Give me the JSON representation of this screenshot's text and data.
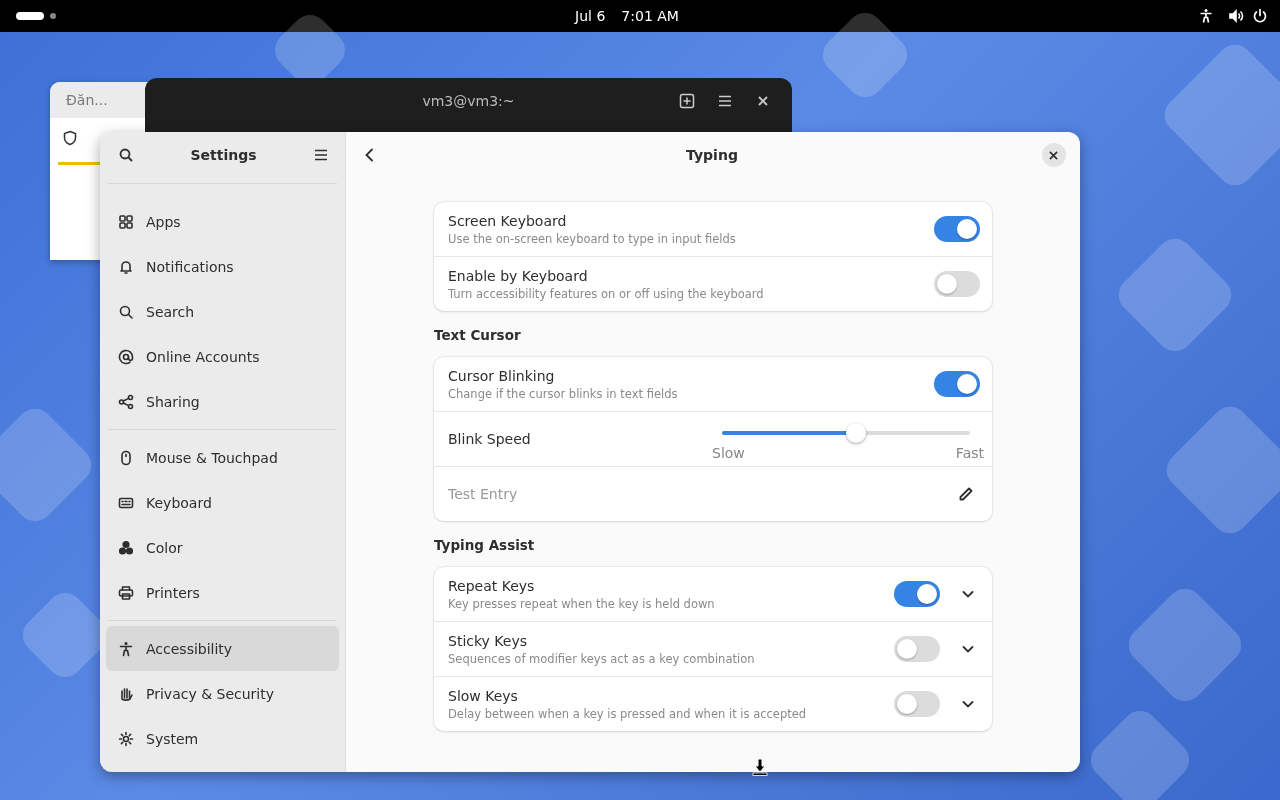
{
  "top_bar": {
    "date": "Jul 6",
    "time": "7:01 AM"
  },
  "background_windows": [
    {
      "kind": "browser",
      "title": "Đăn..."
    },
    {
      "kind": "terminal",
      "title": "vm3@vm3:~"
    }
  ],
  "settings": {
    "sidebar": {
      "title": "Settings",
      "groups": [
        [
          {
            "label": "Apps",
            "selected": false
          },
          {
            "label": "Notifications",
            "selected": false
          },
          {
            "label": "Search",
            "selected": false
          },
          {
            "label": "Online Accounts",
            "selected": false
          },
          {
            "label": "Sharing",
            "selected": false
          }
        ],
        [
          {
            "label": "Mouse & Touchpad",
            "selected": false
          },
          {
            "label": "Keyboard",
            "selected": false
          },
          {
            "label": "Color",
            "selected": false
          },
          {
            "label": "Printers",
            "selected": false
          }
        ],
        [
          {
            "label": "Accessibility",
            "selected": true
          },
          {
            "label": "Privacy & Security",
            "selected": false
          },
          {
            "label": "System",
            "selected": false
          }
        ]
      ]
    },
    "page": {
      "title": "Typing",
      "sections": [
        {
          "rows": [
            {
              "kind": "switch",
              "title": "Screen Keyboard",
              "subtitle": "Use the on-screen keyboard to type in input fields",
              "on": true
            },
            {
              "kind": "switch",
              "title": "Enable by Keyboard",
              "subtitle": "Turn accessibility features on or off using the keyboard",
              "on": false
            }
          ]
        },
        {
          "heading": "Text Cursor",
          "rows": [
            {
              "kind": "switch",
              "title": "Cursor Blinking",
              "subtitle": "Change if the cursor blinks in text fields",
              "on": true
            },
            {
              "kind": "slider",
              "title": "Blink Speed",
              "level": 0.54,
              "min_label": "Slow",
              "max_label": "Fast"
            },
            {
              "kind": "entry",
              "placeholder": "Test Entry"
            }
          ]
        },
        {
          "heading": "Typing Assist",
          "rows": [
            {
              "kind": "switch",
              "title": "Repeat Keys",
              "subtitle": "Key presses repeat when the key is held down",
              "on": true,
              "expandable": true
            },
            {
              "kind": "switch",
              "title": "Sticky Keys",
              "subtitle": "Sequences of modifier keys act as a key combination",
              "on": false,
              "expandable": true
            },
            {
              "kind": "switch",
              "title": "Slow Keys",
              "subtitle": "Delay between when a key is pressed and when it is accepted",
              "on": false,
              "expandable": true
            }
          ]
        }
      ]
    }
  }
}
